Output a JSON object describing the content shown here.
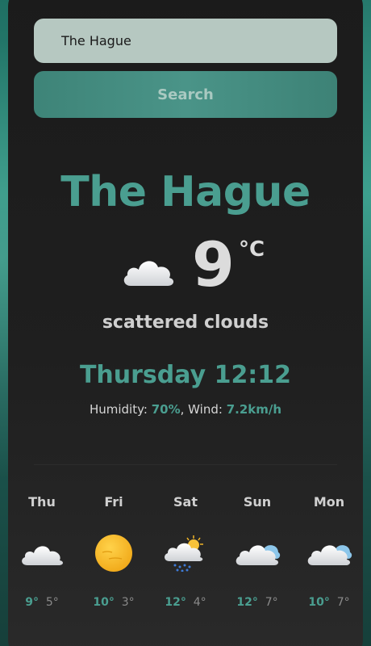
{
  "search": {
    "value": "The Hague",
    "button_label": "Search"
  },
  "current": {
    "city": "The Hague",
    "temperature": "9",
    "unit": "°C",
    "description": "scattered clouds",
    "icon": "cloud-icon",
    "datetime": "Thursday 12:12",
    "humidity_label": "Humidity: ",
    "humidity": "70%",
    "wind_label": ", Wind: ",
    "wind": "7.2km/h"
  },
  "forecast": [
    {
      "day": "Thu",
      "max": "9°",
      "min": "5°",
      "icon": "cloud-icon"
    },
    {
      "day": "Fri",
      "max": "10°",
      "min": "3°",
      "icon": "sun-icon"
    },
    {
      "day": "Sat",
      "max": "12°",
      "min": "4°",
      "icon": "rain-sun-cloud-icon"
    },
    {
      "day": "Sun",
      "max": "12°",
      "min": "7°",
      "icon": "cloud-icon"
    },
    {
      "day": "Mon",
      "max": "10°",
      "min": "7°",
      "icon": "cloud-icon"
    }
  ],
  "colors": {
    "accent": "#4a9e90",
    "card": "#1b1b1b",
    "input": "#b6c8c1"
  }
}
